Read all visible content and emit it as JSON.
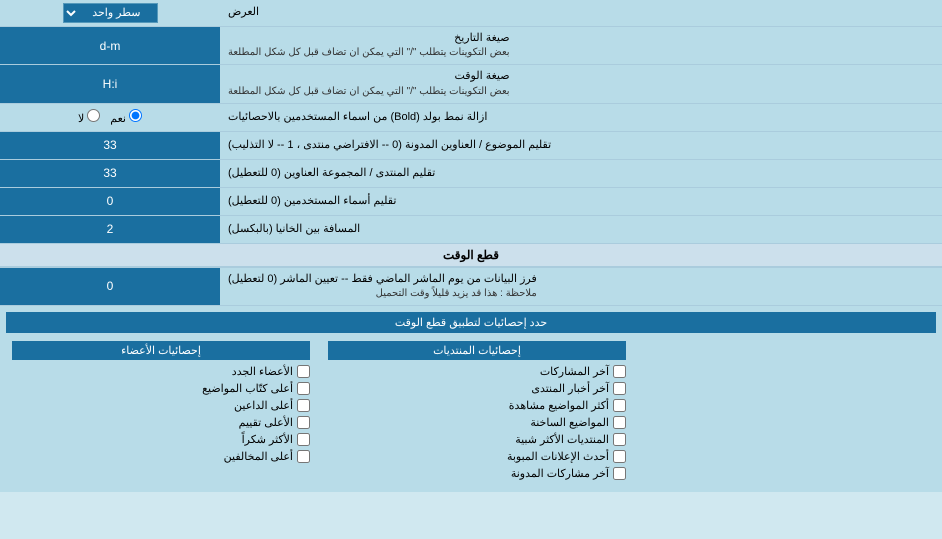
{
  "header": {
    "label": "العرض",
    "select_label": "سطر واحد"
  },
  "rows": [
    {
      "id": "date_format",
      "label": "صيغة التاريخ",
      "sublabel": "بعض التكوينات يتطلب \"/\" التي يمكن ان تضاف قبل كل شكل المطلعة",
      "value": "d-m",
      "type": "text"
    },
    {
      "id": "time_format",
      "label": "صيغة الوقت",
      "sublabel": "بعض التكوينات يتطلب \"/\" التي يمكن ان تضاف قبل كل شكل المطلعة",
      "value": "H:i",
      "type": "text"
    },
    {
      "id": "bold_remove",
      "label": "ازالة نمط بولد (Bold) من اسماء المستخدمين بالاحصائيات",
      "type": "radio",
      "options": [
        "نعم",
        "لا"
      ],
      "selected": "نعم"
    },
    {
      "id": "topics_per_forum",
      "label": "تقليم الموضوع / العناوين المدونة (0 -- الافتراضي منتدى ، 1 -- لا التذليب)",
      "value": "33",
      "type": "text"
    },
    {
      "id": "forum_group",
      "label": "تقليم المنتدى / المجموعة العناوين (0 للتعطيل)",
      "value": "33",
      "type": "text"
    },
    {
      "id": "user_names",
      "label": "تقليم أسماء المستخدمين (0 للتعطيل)",
      "value": "0",
      "type": "text"
    },
    {
      "id": "space_between",
      "label": "المسافة بين الخانيا (بالبكسل)",
      "value": "2",
      "type": "text"
    }
  ],
  "time_cut_section": {
    "title": "قطع الوقت",
    "row": {
      "label_main": "فرز البيانات من يوم الماشر الماضي فقط -- تعيين الماشر (0 لتعطيل)",
      "label_note": "ملاحظة : هذا قد يزيد قليلاً وقت التحميل",
      "value": "0",
      "type": "text"
    },
    "stats_label": "حدد إحصائيات لتطبيق قطع الوقت"
  },
  "checkboxes": {
    "col1_header": "إحصائيات المنتديات",
    "col1_items": [
      "آخر المشاركات",
      "آخر أخبار المنتدى",
      "أكثر المواضيع مشاهدة",
      "المواضيع الساخنة",
      "المنتديات الأكثر شبية",
      "أحدث الإعلانات المبوبة",
      "آخر مشاركات المدونة"
    ],
    "col2_header": "إحصائيات الأعضاء",
    "col2_items": [
      "الأعضاء الجدد",
      "أعلى كتّاب المواضيع",
      "أعلى الداعين",
      "الأعلى تقييم",
      "الأكثر شكراً",
      "أعلى المخالفين"
    ]
  }
}
